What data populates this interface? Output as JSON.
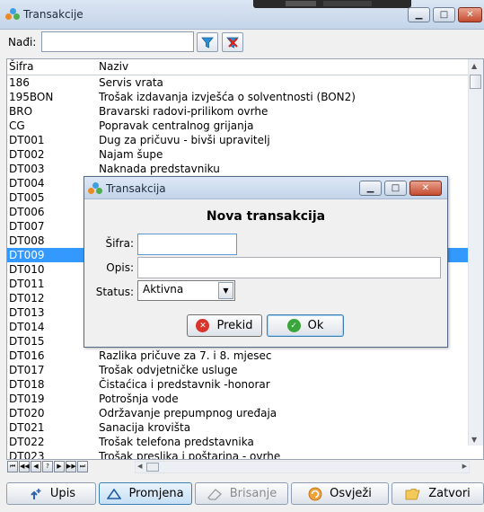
{
  "window": {
    "title": "Transakcije",
    "minimize": "▁",
    "maximize": "□",
    "close": "✕"
  },
  "search": {
    "label": "Nađi:",
    "value": "",
    "filter_icon": "filter-icon",
    "clear_icon": "clear-filter-icon"
  },
  "grid": {
    "columns": [
      "Šifra",
      "Naziv"
    ],
    "rows": [
      [
        "186",
        "Servis vrata"
      ],
      [
        "195BON",
        "Trošak izdavanja izvješća o solventnosti (BON2)"
      ],
      [
        "BRO",
        "Bravarski radovi-prilikom ovrhe"
      ],
      [
        "CG",
        "Popravak centralnog grijanja"
      ],
      [
        "DT001",
        "Dug za pričuvu - bivši upravitelj"
      ],
      [
        "DT002",
        "Najam šupe"
      ],
      [
        "DT003",
        "Naknada predstavniku"
      ],
      [
        "DT004",
        ""
      ],
      [
        "DT005",
        ""
      ],
      [
        "DT006",
        ""
      ],
      [
        "DT007",
        ""
      ],
      [
        "DT008",
        ""
      ],
      [
        "DT009",
        ""
      ],
      [
        "DT010",
        ""
      ],
      [
        "DT011",
        ""
      ],
      [
        "DT012",
        ""
      ],
      [
        "DT013",
        ""
      ],
      [
        "DT014",
        ""
      ],
      [
        "DT015",
        ""
      ],
      [
        "DT016",
        "Razlika pričuve za 7. i 8. mjesec"
      ],
      [
        "DT017",
        "Trošak odvjetničke usluge"
      ],
      [
        "DT018",
        "Čistaćica i predstavnik -honorar"
      ],
      [
        "DT019",
        "Potrošnja vode"
      ],
      [
        "DT020",
        "Održavanje prepumpnog uređaja"
      ],
      [
        "DT021",
        "Sanacija krovišta"
      ],
      [
        "DT022",
        "Trošak telefona predstavnika"
      ],
      [
        "DT023",
        "Trošak preslika i poštarina - ovrhe"
      ]
    ],
    "selected_index": 12
  },
  "navigator": [
    "⏮",
    "◀◀",
    "◀",
    "?",
    "▶",
    "▶▶",
    "⏭"
  ],
  "buttons": {
    "upis": "Upis",
    "promjena": "Promjena",
    "brisanje": "Brisanje",
    "osvjezi": "Osvježi",
    "zatvori": "Zatvori"
  },
  "dialog": {
    "title": "Transakcija",
    "heading": "Nova transakcija",
    "sifra_label": "Šifra:",
    "sifra_value": "",
    "opis_label": "Opis:",
    "opis_value": "",
    "status_label": "Status:",
    "status_value": "Aktivna",
    "cancel": "Prekid",
    "ok": "Ok"
  },
  "colors": {
    "selection": "#3399ff",
    "cancel_icon": "#d9342b",
    "ok_icon": "#3aa53a"
  }
}
